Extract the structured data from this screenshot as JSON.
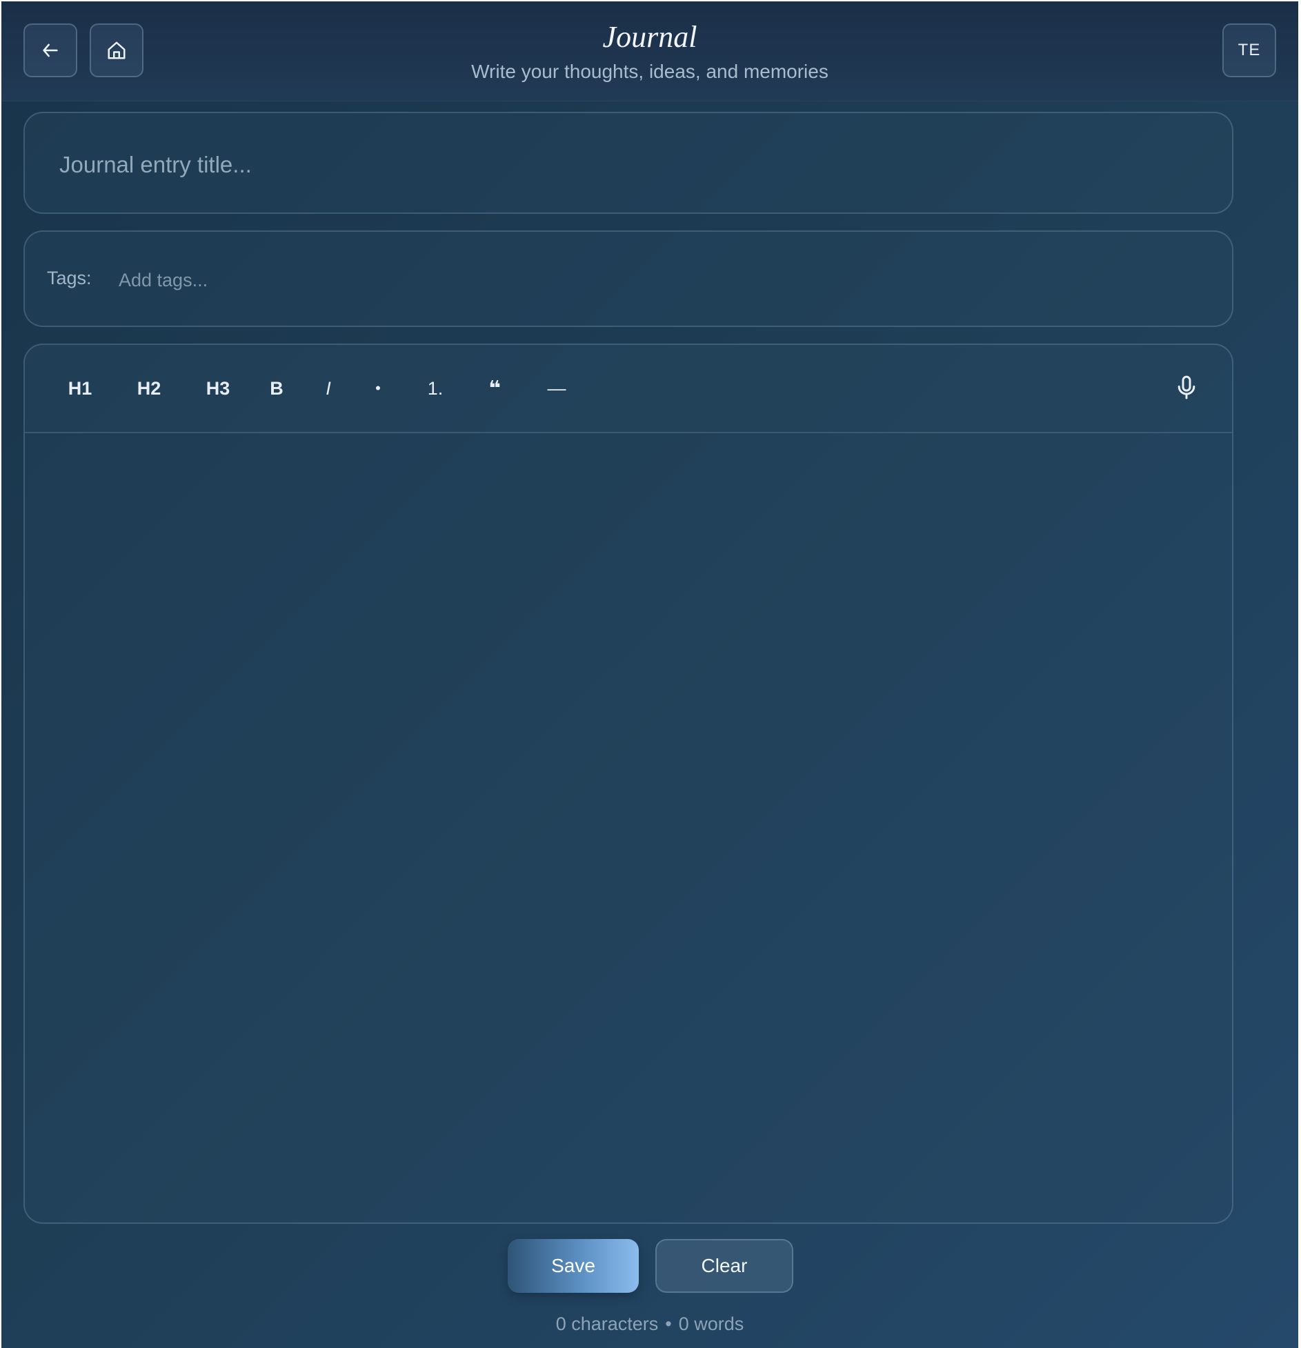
{
  "header": {
    "title": "Journal",
    "subtitle": "Write your thoughts, ideas, and memories",
    "avatar_initials": "TE",
    "back_icon": "arrow-left-icon",
    "home_icon": "home-icon"
  },
  "title_field": {
    "value": "",
    "placeholder": "Journal entry title..."
  },
  "tags_field": {
    "label": "Tags:",
    "value": "",
    "placeholder": "Add tags..."
  },
  "toolbar": {
    "items": [
      {
        "label": "H1",
        "name": "heading-1-button"
      },
      {
        "label": "H2",
        "name": "heading-2-button"
      },
      {
        "label": "H3",
        "name": "heading-3-button"
      },
      {
        "label": "B",
        "name": "bold-button"
      },
      {
        "label": "I",
        "name": "italic-button"
      },
      {
        "label": "•",
        "name": "bullet-list-button"
      },
      {
        "label": "1.",
        "name": "numbered-list-button"
      },
      {
        "label": "❝",
        "name": "quote-button"
      },
      {
        "label": "—",
        "name": "horizontal-rule-button"
      }
    ],
    "mic_icon": "microphone-icon"
  },
  "editor": {
    "content": ""
  },
  "actions": {
    "save_label": "Save",
    "clear_label": "Clear"
  },
  "stats": {
    "characters": "0 characters",
    "separator": "•",
    "words": "0 words"
  },
  "colors": {
    "background": "#1e3d55",
    "header": "#1b2e47",
    "accent": "#8cbcee",
    "text": "#e8eef5"
  }
}
